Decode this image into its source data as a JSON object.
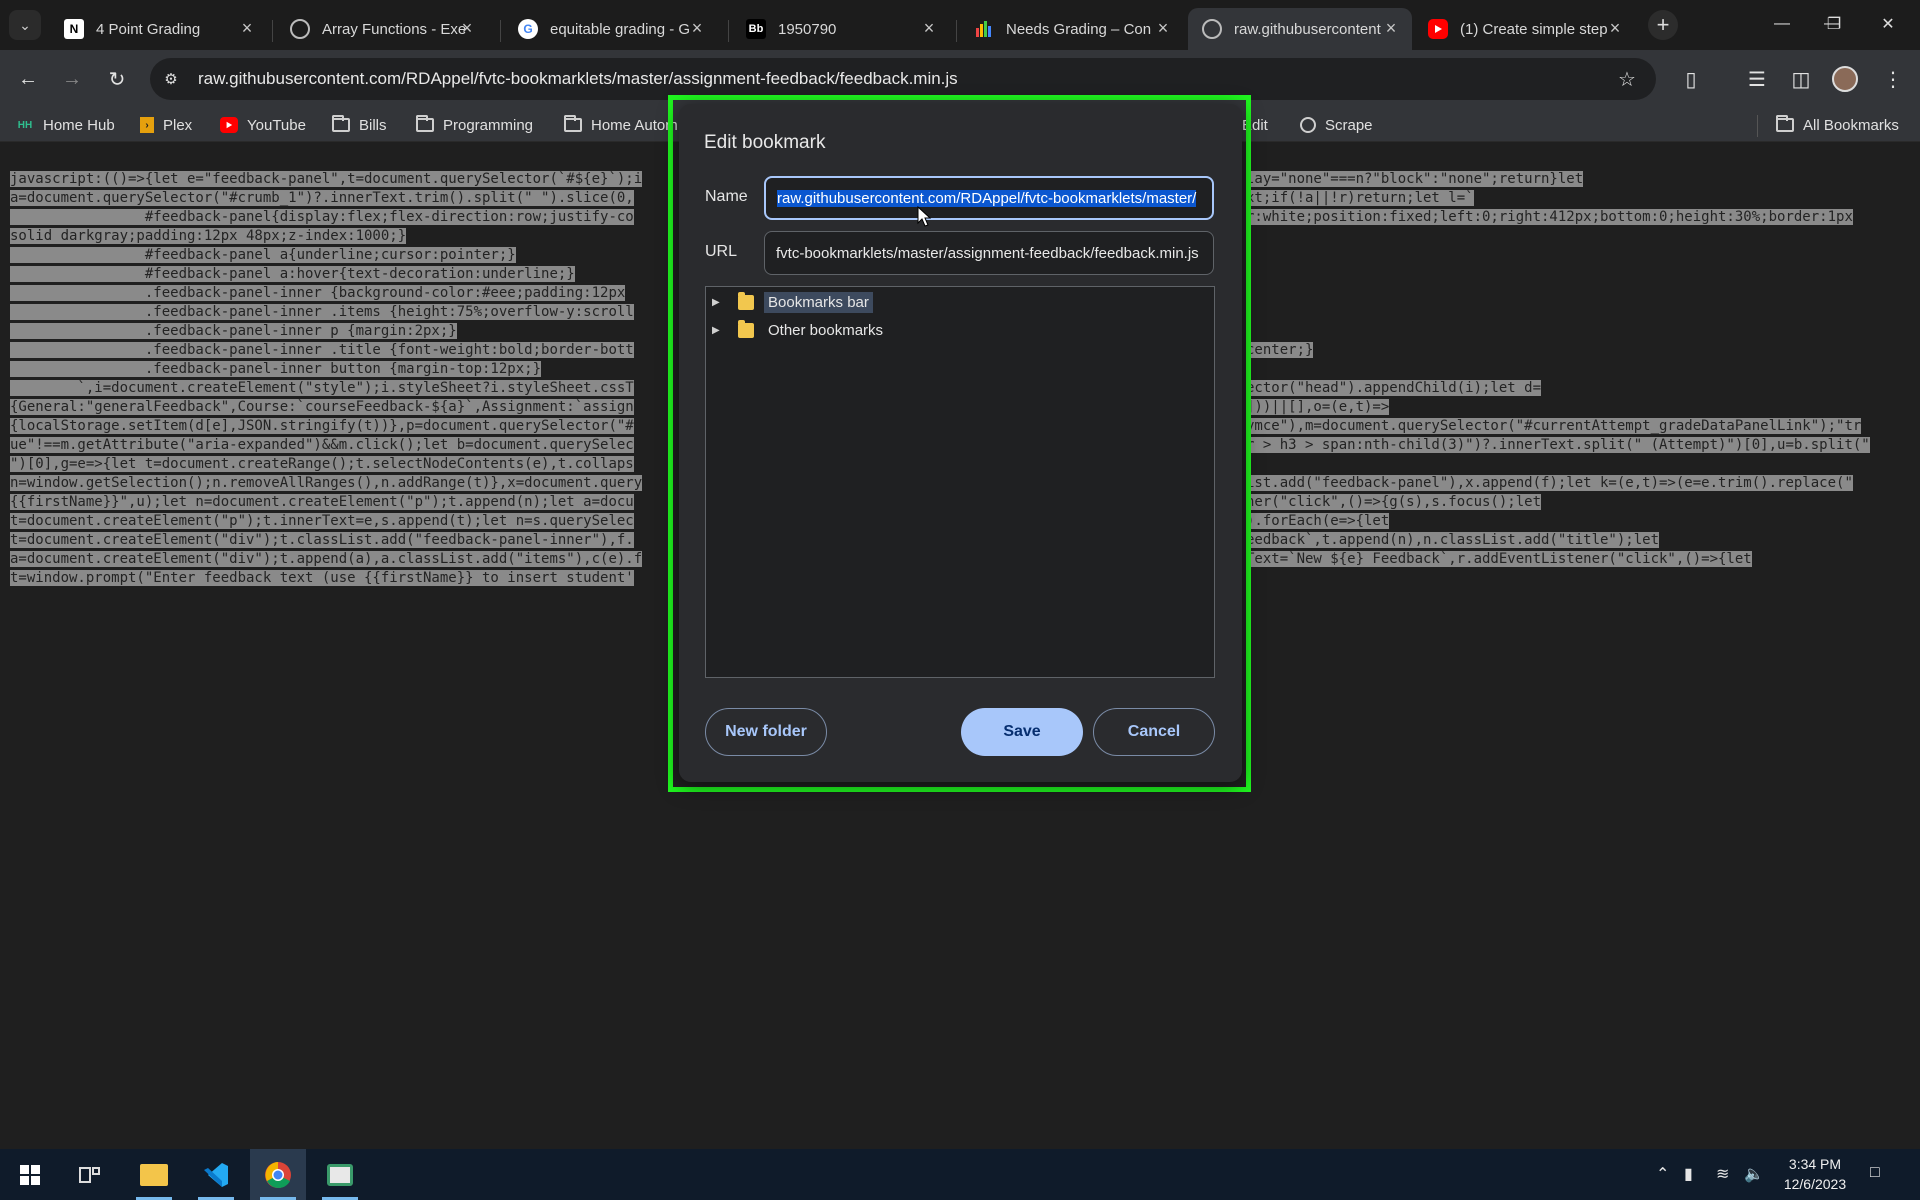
{
  "tabs": [
    {
      "title": "4 Point Grading",
      "icon": "notion-icon",
      "fav": "N"
    },
    {
      "title": "Array Functions - Exe",
      "icon": "globe-icon",
      "fav": ""
    },
    {
      "title": "equitable grading - G",
      "icon": "google-icon",
      "fav": "G"
    },
    {
      "title": "1950790",
      "icon": "blackboard-icon",
      "fav": "Bb"
    },
    {
      "title": "Needs Grading – Con",
      "icon": "chart-icon",
      "fav": ""
    },
    {
      "title": "raw.githubusercontent",
      "icon": "globe-icon",
      "fav": ""
    },
    {
      "title": "(1) Create simple step",
      "icon": "youtube-icon",
      "fav": ""
    }
  ],
  "toolbar": {
    "url": "raw.githubusercontent.com/RDAppel/fvtc-bookmarklets/master/assignment-feedback/feedback.min.js"
  },
  "bookmarks": [
    {
      "label": "Home Hub",
      "icon": "homehub-icon",
      "fav": "HH"
    },
    {
      "label": "Plex",
      "icon": "plex-icon",
      "fav": "›"
    },
    {
      "label": "YouTube",
      "icon": "youtube-icon",
      "fav": ""
    },
    {
      "label": "Bills",
      "icon": "folder-icon"
    },
    {
      "label": "Programming",
      "icon": "folder-icon"
    },
    {
      "label": "Home Autom",
      "icon": "folder-icon"
    },
    {
      "label": "Edit",
      "icon": "folder-icon"
    },
    {
      "label": "Scrape",
      "icon": "globe-icon"
    },
    {
      "label": "All Bookmarks",
      "icon": "folder-icon"
    }
  ],
  "code_lines": [
    "javascript:(()=>{let e=\"feedback-panel\",t=document.querySelector(`#${e}`);i",
    "a=document.querySelector(\"#crumb_1\")?.innerText.trim().split(\" \").slice(0,",
    "                #feedback-panel{display:flex;flex-direction:row;justify-co",
    "solid darkgray;padding:12px 48px;z-index:1000;}",
    "                #feedback-panel a{underline;cursor:pointer;}",
    "                #feedback-panel a:hover{text-decoration:underline;}",
    "                .feedback-panel-inner {background-color:#eee;padding:12px",
    "                .feedback-panel-inner .items {height:75%;overflow-y:scroll",
    "                .feedback-panel-inner p {margin:2px;}",
    "                .feedback-panel-inner .title {font-weight:bold;border-bott",
    "                .feedback-panel-inner button {margin-top:12px;}",
    "        `,i=document.createElement(\"style\");i.styleSheet?i.styleSheet.cssT",
    "{General:\"generalFeedback\",Course:`courseFeedback-${a}`,Assignment:`assign",
    "{localStorage.setItem(d[e],JSON.stringify(t))},p=document.querySelector(\"#",
    "ue\"!==m.getAttribute(\"aria-expanded\")&&m.click();let b=document.querySelec",
    "\")[0],g=e=>{let t=document.createRange();t.selectNodeContents(e),t.collaps",
    "n=window.getSelection();n.removeAllRanges(),n.addRange(t)},x=document.query",
    "{{firstName}}\",u);let n=document.createElement(\"p\");t.append(n);let a=docu",
    "t=document.createElement(\"p\");t.innerText=e,s.append(t);let n=s.querySelec",
    "t=document.createElement(\"div\");t.classList.add(\"feedback-panel-inner\"),f.",
    "a=document.createElement(\"div\");t.append(a),a.classList.add(\"items\"),c(e).f",
    "t=window.prompt(\"Enter feedback text (use {{firstName}} to insert student'"
  ],
  "code_lines_right": [
    "lay=\"none\"===n?\"block\":\"none\";return}let",
    "xt;if(!a||!r)return;let l=`",
    "r:white;position:fixed;left:0;right:412px;bottom:0;height:30%;border:1px",
    "",
    "",
    "",
    "",
    "",
    "",
    "center;}",
    "",
    "ector(\"head\").appendChild(i);let d=",
    "]))||[],o=(e,t)=>",
    "ymce\"),m=document.querySelector(\"#currentAttempt_gradeDataPanelLink\");\"tr",
    "r > h3 > span:nth-child(3)\")?.innerText.split(\" (Attempt)\")[0],u=b.split(\"",
    "",
    "ist.add(\"feedback-panel\"),x.append(f);let k=(e,t)=>(e=e.trim().replace(\"",
    "ner(\"click\",()=>{g(s),s.focus();let",
    ").forEach(e=>{let",
    "eedback`,t.append(n),n.classList.add(\"title\");let",
    "Text=`New ${e} Feedback`,r.addEventListener(\"click\",()=>{let",
    ""
  ],
  "dialog": {
    "title": "Edit bookmark",
    "name_label": "Name",
    "name_value": "raw.githubusercontent.com/RDAppel/fvtc-bookmarklets/master/",
    "url_label": "URL",
    "url_value": "fvtc-bookmarklets/master/assignment-feedback/feedback.min.js",
    "folders": [
      "Bookmarks bar",
      "Other bookmarks"
    ],
    "new_folder": "New folder",
    "save": "Save",
    "cancel": "Cancel"
  },
  "taskbar": {
    "time": "3:34 PM",
    "date": "12/6/2023"
  },
  "colors": {
    "accent": "#a8c7fa",
    "highlight_outline": "#1ff51f",
    "selection": "#0b57d0"
  }
}
